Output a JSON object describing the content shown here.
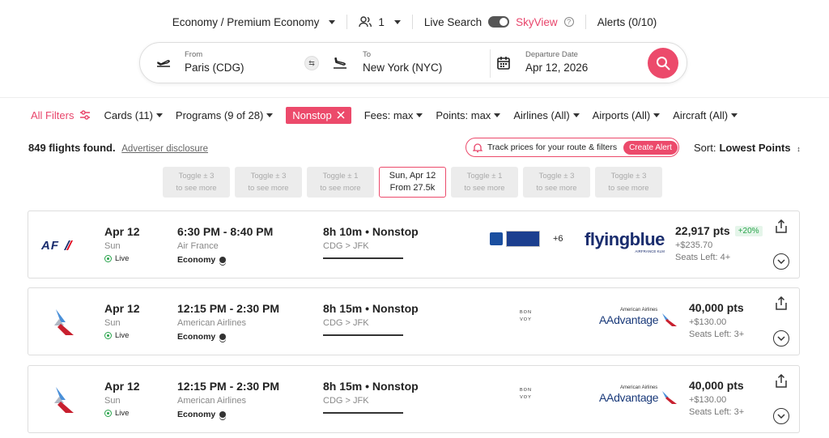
{
  "topbar": {
    "cabin": "Economy / Premium Economy",
    "passengers": "1",
    "live_search": "Live Search",
    "skyview": "SkyView",
    "alerts": "Alerts (0/10)"
  },
  "search": {
    "from_label": "From",
    "from_value": "Paris (CDG)",
    "to_label": "To",
    "to_value": "New York (NYC)",
    "date_label": "Departure Date",
    "date_value": "Apr 12, 2026"
  },
  "filters": {
    "all": "All Filters",
    "cards": "Cards (11)",
    "programs": "Programs (9 of 28)",
    "nonstop": "Nonstop",
    "fees": "Fees: max",
    "points": "Points: max",
    "airlines": "Airlines (All)",
    "airports": "Airports (All)",
    "aircraft": "Aircraft (All)"
  },
  "results": {
    "found": "849 flights found.",
    "disclosure": "Advertiser disclosure",
    "track": "Track prices for your route & filters",
    "create_alert": "Create Alert",
    "sort_label": "Sort:",
    "sort_value": "Lowest Points"
  },
  "date_strip": [
    {
      "l1": "Toggle ± 3",
      "l2": "to see more"
    },
    {
      "l1": "Toggle ± 3",
      "l2": "to see more"
    },
    {
      "l1": "Toggle ± 1",
      "l2": "to see more"
    },
    {
      "l1": "Sun, Apr 12",
      "l2": "From 27.5k"
    },
    {
      "l1": "Toggle ± 1",
      "l2": "to see more"
    },
    {
      "l1": "Toggle ± 3",
      "l2": "to see more"
    },
    {
      "l1": "Toggle ± 3",
      "l2": "to see more"
    }
  ],
  "flights": [
    {
      "date": "Apr 12",
      "weekday": "Sun",
      "live": "Live",
      "time": "6:30 PM - 8:40 PM",
      "airline": "Air France",
      "cabin": "Economy",
      "duration": "8h 10m • Nonstop",
      "route": "CDG > JFK",
      "extra_cards": "+6",
      "program": "Flyingblue",
      "program_sub": "AIRFRANCE KLM",
      "points": "22,917 pts",
      "pct": "+20%",
      "tax": "+$235.70",
      "seats": "Seats Left: 4+"
    },
    {
      "date": "Apr 12",
      "weekday": "Sun",
      "live": "Live",
      "time": "12:15 PM - 2:30 PM",
      "airline": "American Airlines",
      "cabin": "Economy",
      "duration": "8h 15m • Nonstop",
      "route": "CDG > JFK",
      "card_top": "BON",
      "card_bottom": "VOY",
      "program_top": "American Airlines",
      "program": "AAdvantage",
      "points": "40,000 pts",
      "tax": "+$130.00",
      "seats": "Seats Left: 3+"
    },
    {
      "date": "Apr 12",
      "weekday": "Sun",
      "live": "Live",
      "time": "12:15 PM - 2:30 PM",
      "airline": "American Airlines",
      "cabin": "Economy",
      "duration": "8h 15m • Nonstop",
      "route": "CDG > JFK",
      "card_top": "BON",
      "card_bottom": "VOY",
      "program_top": "American Airlines",
      "program": "AAdvantage",
      "points": "40,000 pts",
      "tax": "+$130.00",
      "seats": "Seats Left: 3+"
    }
  ],
  "logos": {
    "af": "AF"
  },
  "colors": {
    "accent": "#ec4a6b",
    "live": "#27a34a",
    "flyingblue": "#1a2d6e",
    "aa_blue": "#1a3a7a",
    "aa_red": "#c8202f"
  }
}
